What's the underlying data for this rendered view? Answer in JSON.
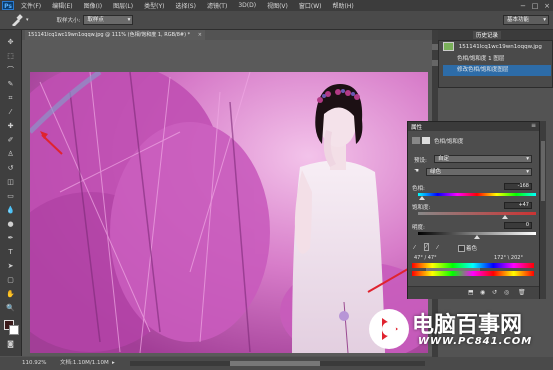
{
  "app": {
    "logo": "Ps",
    "menu": [
      "文件(F)",
      "编辑(E)",
      "图像(I)",
      "图层(L)",
      "类型(Y)",
      "选择(S)",
      "滤镜(T)",
      "3D(D)",
      "视图(V)",
      "窗口(W)",
      "帮助(H)"
    ],
    "window_controls": [
      "−",
      "□",
      "×"
    ]
  },
  "options_bar": {
    "sample_size_label": "取样大小:",
    "sample_size_value": "取样点",
    "workspace_value": "基本功能"
  },
  "document": {
    "tab_title": "151141lcq1wc19wn1oqqw.jpg @ 111% (色相/饱和度 1, RGB/8#) *",
    "tab_close": "×"
  },
  "status": {
    "zoom": "110.92%",
    "doc_info": "文档:1.10M/1.10M"
  },
  "history": {
    "tabs": [
      "历史记录"
    ],
    "snapshot_label": "151141lcq1wc19wn1oqqw.jpg",
    "items": [
      "色相/饱和度 1 图层",
      "修改色相/饱和度图层"
    ]
  },
  "properties": {
    "tab": "属性",
    "title": "色相/饱和度",
    "preset_label": "预设:",
    "preset_value": "自定",
    "channel_value": "绿色",
    "hue_label": "色相:",
    "hue_value": "-168",
    "sat_label": "饱和度:",
    "sat_value": "+47",
    "light_label": "明度:",
    "light_value": "0",
    "colorize_label": "着色",
    "range_left": "47° / 47°",
    "range_right": "172° \\ 202°"
  },
  "hue_slider": {
    "value": -168,
    "min": -180,
    "max": 180
  },
  "sat_slider": {
    "value": 47,
    "min": -100,
    "max": 100
  },
  "light_slider": {
    "value": 0,
    "min": -100,
    "max": 100
  },
  "watermark": {
    "text": "电脑百事网",
    "url": "WWW.PC841.COM"
  },
  "colors": {
    "accent": "#2d6ca8",
    "canvas_magenta": "#c05ab5",
    "annotation_red": "#e0232f"
  }
}
